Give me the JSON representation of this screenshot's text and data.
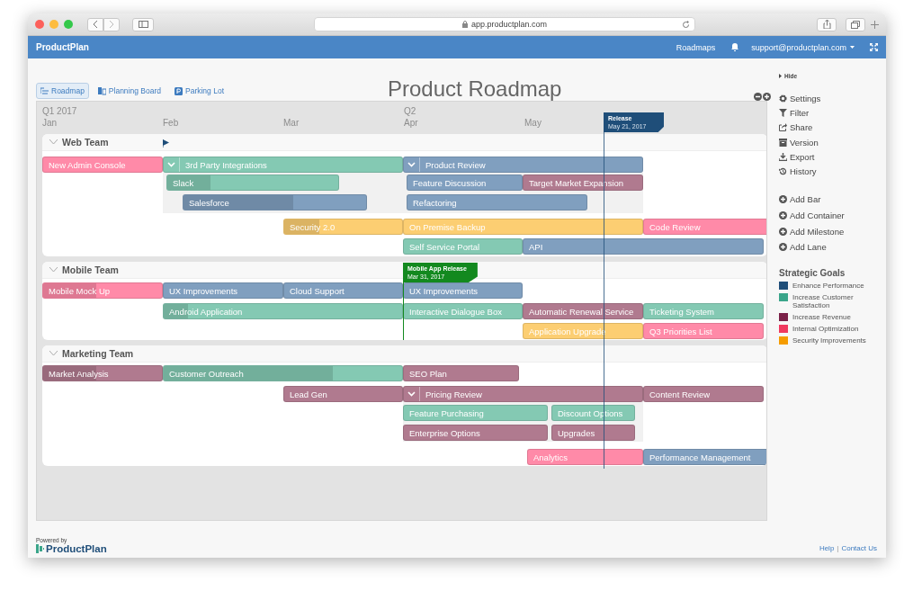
{
  "browser": {
    "url": "app.productplan.com"
  },
  "app_header": {
    "brand": "ProductPlan",
    "nav": "Roadmaps",
    "account": "support@productplan.com"
  },
  "view_tabs": [
    {
      "label": "Roadmap",
      "selected": true
    },
    {
      "label": "Planning Board",
      "selected": false
    },
    {
      "label": "Parking Lot",
      "selected": false
    }
  ],
  "title": "Product Roadmap",
  "timeline": {
    "months": [
      {
        "quarter": "Q1 2017",
        "month": "Jan"
      },
      {
        "month": "Feb"
      },
      {
        "month": "Mar"
      },
      {
        "quarter": "Q2",
        "month": "Apr"
      },
      {
        "month": "May"
      }
    ],
    "release": {
      "title": "Release",
      "date": "May 21, 2017",
      "color": "#1f4e79"
    },
    "lanes": [
      {
        "name": "Web Team",
        "expanded": true,
        "milestones": [
          {
            "kind": "flag",
            "color": "#1f4e79"
          }
        ],
        "bars": [
          {
            "label": "New Admin Console",
            "kind": "bar",
            "color": "#ff8aa8"
          },
          {
            "label": "3rd Party Integrations",
            "kind": "container",
            "color": "#84c9b3"
          },
          {
            "label": "Product Review",
            "kind": "container",
            "color": "#809fbf"
          },
          {
            "label": "Slack",
            "kind": "bar",
            "color": "#84c9b3",
            "level": 0.25
          },
          {
            "label": "Feature Discussion",
            "kind": "bar",
            "color": "#809fbf"
          },
          {
            "label": "Target Market Expansion",
            "kind": "bar",
            "color": "#b07a8f"
          },
          {
            "label": "Salesforce",
            "kind": "bar",
            "color": "#809fbf",
            "level": 0.6
          },
          {
            "label": "Refactoring",
            "kind": "bar",
            "color": "#809fbf"
          },
          {
            "label": "Security 2.0",
            "kind": "bar",
            "color": "#fcce72",
            "level": 0.3
          },
          {
            "label": "On Premise Backup",
            "kind": "bar",
            "color": "#fcce72"
          },
          {
            "label": "Code Review",
            "kind": "bar",
            "color": "#ff8aa8"
          },
          {
            "label": "Self Service Portal",
            "kind": "bar",
            "color": "#84c9b3"
          },
          {
            "label": "API",
            "kind": "bar",
            "color": "#809fbf"
          }
        ]
      },
      {
        "name": "Mobile Team",
        "expanded": true,
        "milestones": [
          {
            "kind": "release",
            "title": "Mobile App Release",
            "date": "Mar 31, 2017",
            "color": "#13891f"
          }
        ],
        "bars": [
          {
            "label": "Mobile Mock Up",
            "kind": "bar",
            "color": "#ff8aa8",
            "level": 0.45
          },
          {
            "label": "UX Improvements",
            "kind": "bar",
            "color": "#809fbf"
          },
          {
            "label": "Cloud Support",
            "kind": "bar",
            "color": "#809fbf"
          },
          {
            "label": "UX Improvements",
            "kind": "bar",
            "color": "#809fbf"
          },
          {
            "label": "Android Application",
            "kind": "bar",
            "color": "#84c9b3",
            "level": 0.1
          },
          {
            "label": "Interactive Dialogue Box",
            "kind": "bar",
            "color": "#84c9b3"
          },
          {
            "label": "Automatic Renewal Service",
            "kind": "bar",
            "color": "#b07a8f"
          },
          {
            "label": "Ticketing System",
            "kind": "bar",
            "color": "#84c9b3"
          },
          {
            "label": "Application Upgrade",
            "kind": "bar",
            "color": "#fcce72"
          },
          {
            "label": "Q3 Priorities List",
            "kind": "bar",
            "color": "#ff8aa8"
          }
        ]
      },
      {
        "name": "Marketing Team",
        "expanded": true,
        "bars": [
          {
            "label": "Market Analysis",
            "kind": "bar",
            "color": "#b07a8f",
            "level": 0.45
          },
          {
            "label": "Customer Outreach",
            "kind": "bar",
            "color": "#84c9b3",
            "level": 0.71
          },
          {
            "label": "SEO Plan",
            "kind": "bar",
            "color": "#b07a8f"
          },
          {
            "label": "Lead Gen",
            "kind": "bar",
            "color": "#b07a8f"
          },
          {
            "label": "Pricing Review",
            "kind": "container",
            "color": "#b07a8f"
          },
          {
            "label": "Content Review",
            "kind": "bar",
            "color": "#b07a8f"
          },
          {
            "label": "Feature Purchasing",
            "kind": "bar",
            "color": "#84c9b3"
          },
          {
            "label": "Discount Options",
            "kind": "bar",
            "color": "#84c9b3"
          },
          {
            "label": "Enterprise Options",
            "kind": "bar",
            "color": "#b07a8f"
          },
          {
            "label": "Upgrades",
            "kind": "bar",
            "color": "#b07a8f"
          },
          {
            "label": "Analytics",
            "kind": "bar",
            "color": "#ff8aa8"
          },
          {
            "label": "Performance Management",
            "kind": "bar",
            "color": "#809fbf"
          }
        ]
      }
    ]
  },
  "sidebar": {
    "hide": "Hide",
    "actions": [
      {
        "label": "Settings",
        "kind": "settings"
      },
      {
        "label": "Filter",
        "kind": "filter"
      },
      {
        "label": "Share",
        "kind": "share"
      },
      {
        "label": "Version",
        "kind": "version"
      },
      {
        "label": "Export",
        "kind": "export"
      },
      {
        "label": "History",
        "kind": "history"
      }
    ],
    "add_actions": [
      "Add Bar",
      "Add Container",
      "Add Milestone",
      "Add Lane"
    ],
    "legend": {
      "title": "Strategic Goals",
      "goals": [
        {
          "label": "Enhance Performance",
          "color": "#1f4e79"
        },
        {
          "label": "Increase Customer Satisfaction",
          "color": "#3aa58a"
        },
        {
          "label": "Increase Revenue",
          "color": "#7a2148"
        },
        {
          "label": "Internal Optimization",
          "color": "#f0395f"
        },
        {
          "label": "Security Improvements",
          "color": "#f59c00"
        }
      ]
    }
  },
  "footer": {
    "powered_by": "Powered by",
    "logo": "ProductPlan",
    "links": [
      "Help",
      "Contact Us"
    ],
    "separator": "|"
  }
}
